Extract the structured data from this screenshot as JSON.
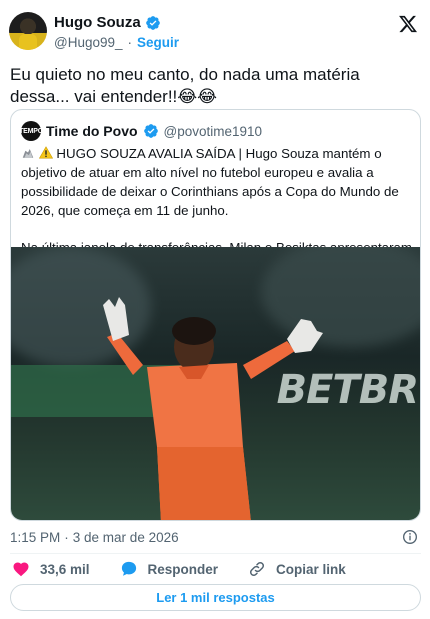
{
  "author": {
    "name": "Hugo Souza",
    "handle": "@Hugo99_",
    "separator": "·",
    "follow_label": "Seguir"
  },
  "tweet": {
    "text": "Eu quieto no meu canto, do nada uma matéria dessa... vai entender!!😂😂"
  },
  "quoted": {
    "avatar_text": "TEMPO",
    "name": "Time do Povo",
    "handle": "@povotime1910",
    "paragraph1": "HUGO SOUZA AVALIA SAÍDA | Hugo Souza mantém o objetivo de atuar em alto nível no futebol europeu e avalia a possibilidade de deixar o Corinthians após a Copa do Mundo de 2026, que começa em 11 de junho.",
    "paragraph2": "Na última janela de transferências, Milan e Besiktas apresentaram",
    "image_banner_text": "BETBR"
  },
  "meta": {
    "time": "1:15 PM",
    "separator": "·",
    "date": "3 de mar de 2026"
  },
  "actions": {
    "likes": "33,6 mil",
    "reply_label": "Responder",
    "copy_label": "Copiar link"
  },
  "replies_button": "Ler 1 mil respostas",
  "icons": {
    "verified": "verified-badge-icon",
    "x": "x-logo-icon",
    "info": "info-icon",
    "heart": "heart-icon",
    "reply": "speech-bubble-icon",
    "link": "link-icon"
  },
  "colors": {
    "accent": "#1d9bf0",
    "heart": "#f91880",
    "text": "#0f1419",
    "muted": "#536471",
    "border": "#cfd9de"
  }
}
